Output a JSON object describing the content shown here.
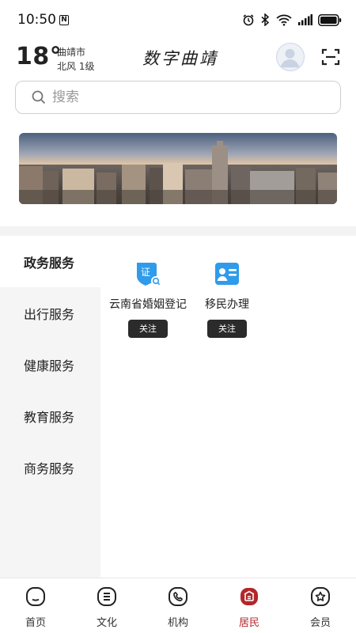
{
  "status_bar": {
    "time": "10:50",
    "carrier_badge": "N"
  },
  "header": {
    "temperature": "18°",
    "city": "曲靖市",
    "wind": "北风  1级",
    "app_title": "数字曲靖",
    "avatar_icon": "user-avatar-icon",
    "scan_icon": "scan-icon"
  },
  "search": {
    "placeholder": "搜索"
  },
  "sidebar": {
    "items": [
      {
        "label": "政务服务"
      },
      {
        "label": "出行服务"
      },
      {
        "label": "健康服务"
      },
      {
        "label": "教育服务"
      },
      {
        "label": "商务服务"
      }
    ],
    "active_index": 0
  },
  "services": [
    {
      "name": "云南省婚姻登记",
      "follow_label": "关注",
      "icon_text": "证",
      "icon": "certificate-icon"
    },
    {
      "name": "移民办理",
      "follow_label": "关注",
      "icon": "id-card-icon"
    }
  ],
  "tabbar": {
    "tabs": [
      {
        "label": "首页",
        "icon": "home-icon"
      },
      {
        "label": "文化",
        "icon": "culture-icon"
      },
      {
        "label": "机构",
        "icon": "phone-icon"
      },
      {
        "label": "居民",
        "icon": "resident-icon"
      },
      {
        "label": "会员",
        "icon": "member-icon"
      }
    ],
    "active_index": 3
  },
  "colors": {
    "accent": "#b3262a",
    "service_blue": "#2f9bea",
    "follow_bg": "#2b2b2b"
  }
}
